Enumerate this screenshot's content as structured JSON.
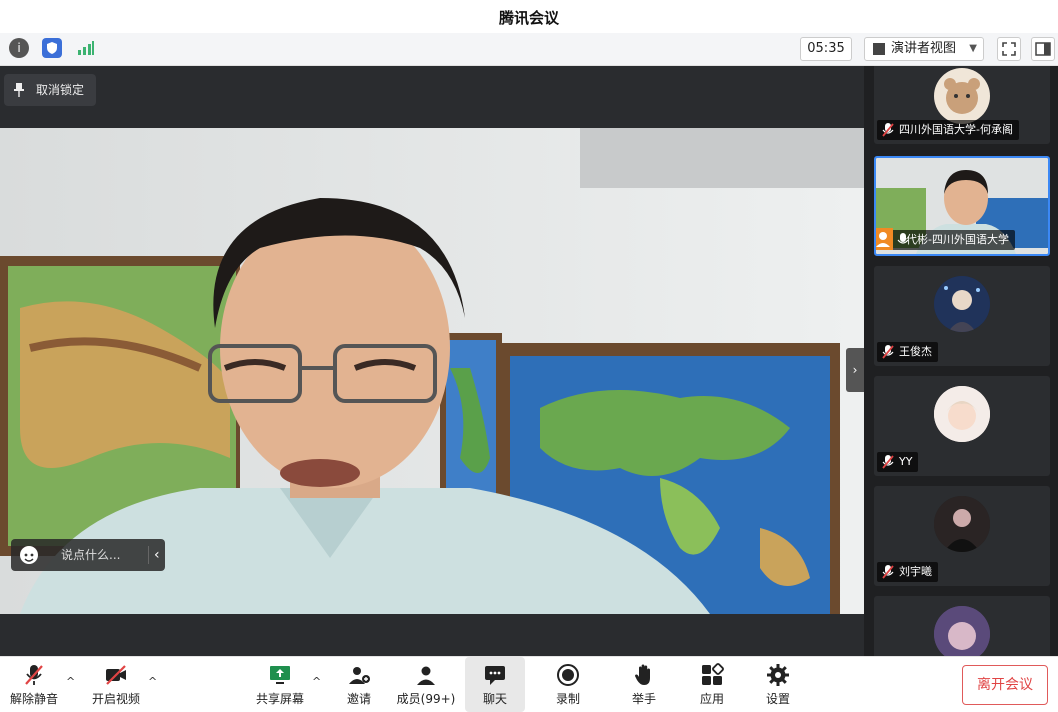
{
  "window": {
    "title": "腾讯会议"
  },
  "toolbar": {
    "timer": "05:35",
    "view_label": "演讲者视图",
    "view_caret": "▼"
  },
  "stage": {
    "unlock_label": "取消锁定",
    "chat_placeholder": "说点什么...",
    "chat_back": "‹",
    "collapse_arrow": "›"
  },
  "participants": [
    {
      "name": "四川外国语大学-何承阁",
      "muted": true
    },
    {
      "name": "代彬-四川外国语大学",
      "muted": false,
      "host": true,
      "active": true
    },
    {
      "name": "王俊杰",
      "muted": true
    },
    {
      "name": "YY",
      "muted": true
    },
    {
      "name": "刘宇曦",
      "muted": true
    }
  ],
  "bottom": {
    "unmute": "解除静音",
    "start_video": "开启视频",
    "share_screen": "共享屏幕",
    "invite": "邀请",
    "members": "成员(99+)",
    "chat": "聊天",
    "record": "录制",
    "raise_hand": "举手",
    "apps": "应用",
    "settings": "设置",
    "leave": "离开会议",
    "caret": "^"
  },
  "colors": {
    "accent": "#3b88f5",
    "leave": "#e04444",
    "host": "#f08a24"
  }
}
